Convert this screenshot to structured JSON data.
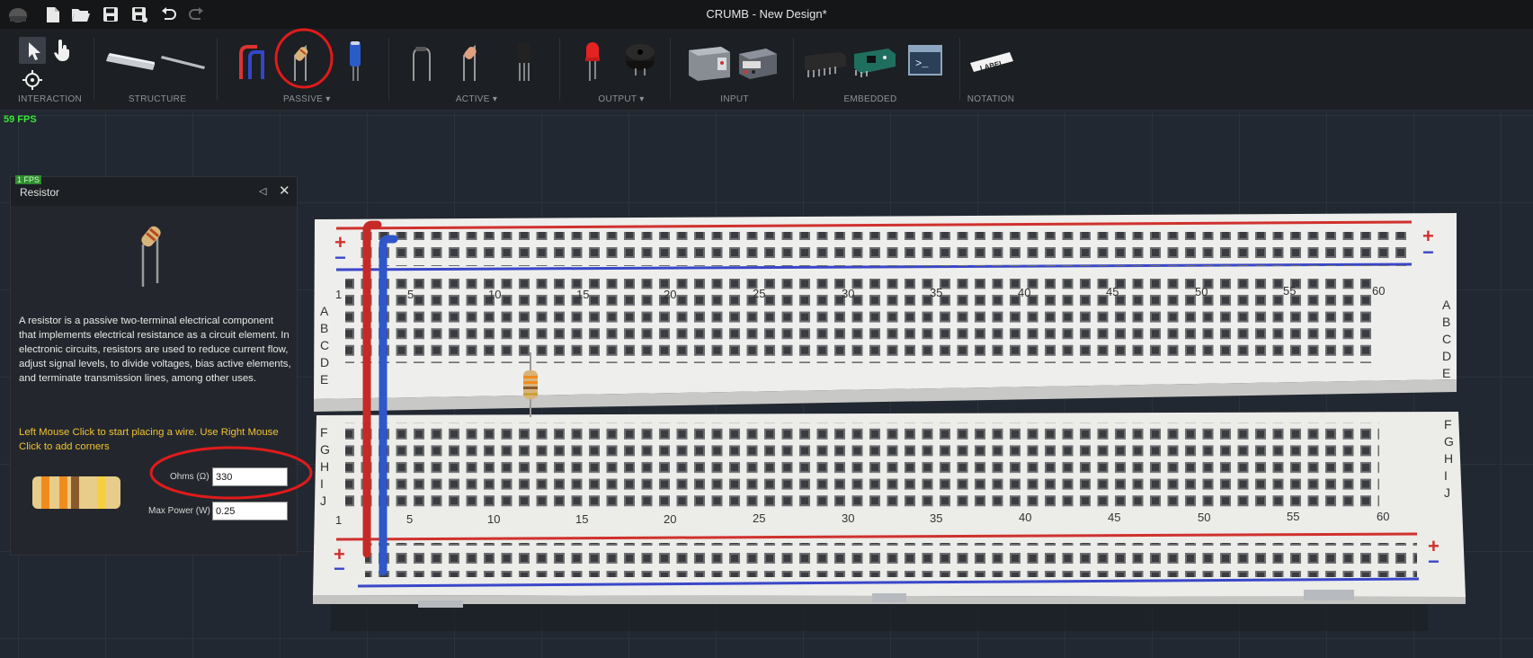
{
  "window": {
    "title": "CRUMB - New Design*"
  },
  "titlebar": {
    "icons": [
      "app-logo-icon",
      "new-file-icon",
      "open-folder-icon",
      "save-icon",
      "save-as-icon",
      "undo-icon",
      "redo-icon"
    ]
  },
  "toolbar": {
    "groups": [
      {
        "label": "INTERACTION",
        "items": [
          "select-pointer-icon",
          "hand-pointer-icon",
          "crosshair-icon"
        ]
      },
      {
        "label": "STRUCTURE",
        "items": [
          "breadboard-long-icon",
          "rod-icon"
        ]
      },
      {
        "label": "PASSIVE",
        "dropdown": true,
        "items": [
          "wire-pair-icon",
          "resistor-icon",
          "capacitor-icon"
        ]
      },
      {
        "label": "ACTIVE",
        "dropdown": true,
        "items": [
          "diode-icon",
          "transistor-icon",
          "ic-transistor-icon"
        ]
      },
      {
        "label": "OUTPUT",
        "dropdown": true,
        "items": [
          "led-icon",
          "buzzer-icon"
        ]
      },
      {
        "label": "INPUT",
        "items": [
          "battery-holder-icon",
          "power-supply-icon"
        ]
      },
      {
        "label": "EMBEDDED",
        "items": [
          "ic-chip-icon",
          "microcontroller-icon",
          "terminal-icon"
        ]
      },
      {
        "label": "NOTATION",
        "items": [
          "label-tag-icon"
        ]
      }
    ],
    "label_tag_text": "LABEL",
    "terminal_text": ">_"
  },
  "status": {
    "fps": "59 FPS",
    "fps_small": "1 FPS"
  },
  "panel": {
    "title": "Resistor",
    "description": "A resistor is a passive two-terminal electrical component that implements electrical resistance as a circuit element. In electronic circuits, resistors are used to reduce current flow, adjust signal levels, to divide voltages, bias active elements, and terminate transmission lines, among other uses.",
    "hint": "Left Mouse Click to start placing a wire. Use Right Mouse Click to add corners",
    "fields": {
      "ohms_label": "Ohms (Ω)",
      "ohms_value": "330",
      "power_label": "Max Power (W)",
      "power_value": "0.25"
    },
    "color_bands": [
      "#f08c1e",
      "#f08c1e",
      "#8b5a2b",
      "#f4d03f"
    ]
  },
  "breadboard": {
    "column_numbers": [
      "1",
      "5",
      "10",
      "15",
      "20",
      "25",
      "30",
      "35",
      "40",
      "45",
      "50",
      "55",
      "60"
    ],
    "top_rows": [
      "A",
      "B",
      "C",
      "D",
      "E"
    ],
    "bottom_rows": [
      "F",
      "G",
      "H",
      "I",
      "J"
    ],
    "rail_plus": "+",
    "rail_minus": "−",
    "colors": {
      "red_rail": "#d0312d",
      "blue_rail": "#3a47c9",
      "board": "#ececea"
    }
  },
  "annotations": {
    "highlight_color": "#e01b1b"
  }
}
